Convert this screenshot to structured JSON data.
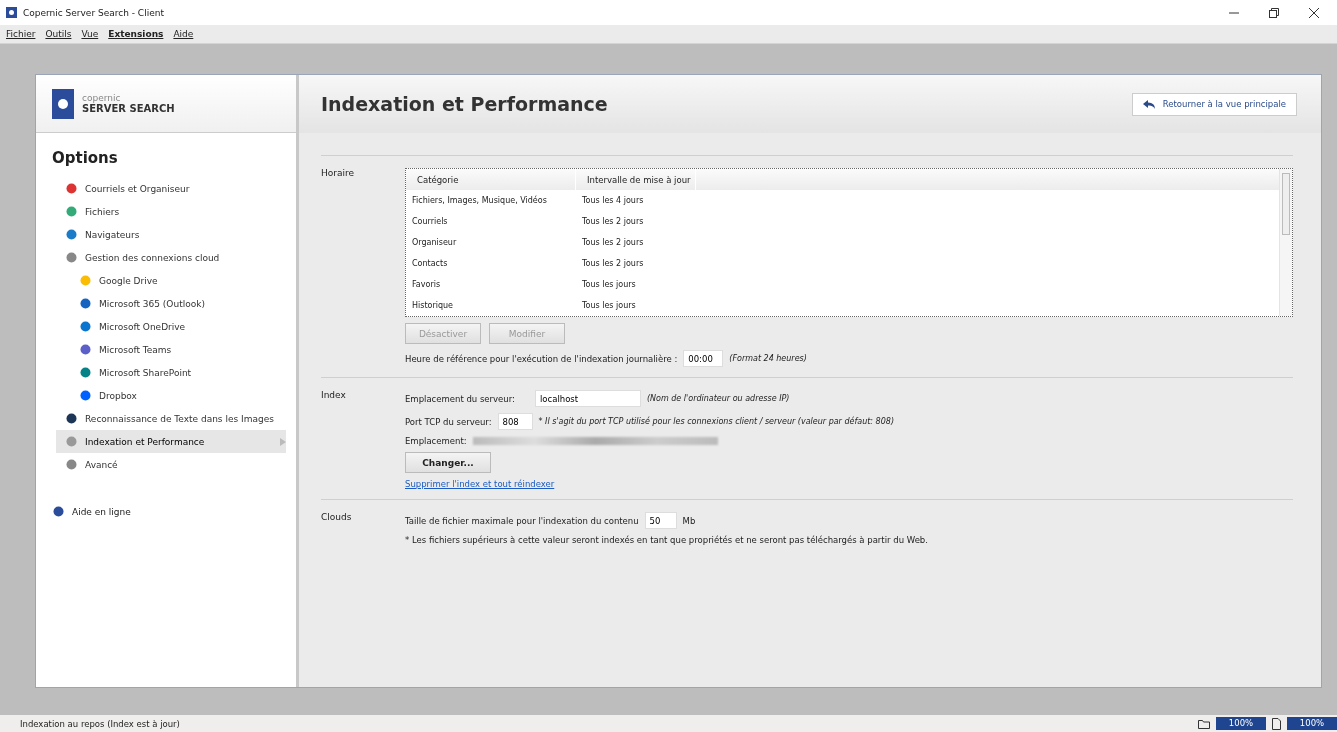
{
  "window": {
    "title": "Copernic Server Search - Client"
  },
  "menu": [
    "Fichier",
    "Outils",
    "Vue",
    "Extensions",
    "Aide"
  ],
  "logo": {
    "line1": "copernic",
    "line2": "SERVER SEARCH"
  },
  "sidebar": {
    "title": "Options",
    "items": [
      {
        "label": "Courriels et Organiseur",
        "selected": false
      },
      {
        "label": "Fichiers",
        "selected": false
      },
      {
        "label": "Navigateurs",
        "selected": false
      },
      {
        "label": "Gestion des connexions cloud",
        "selected": false,
        "children": [
          {
            "label": "Google Drive",
            "selected": false
          },
          {
            "label": "Microsoft 365 (Outlook)",
            "selected": false
          },
          {
            "label": "Microsoft OneDrive",
            "selected": false
          },
          {
            "label": "Microsoft Teams",
            "selected": false
          },
          {
            "label": "Microsoft SharePoint",
            "selected": false
          },
          {
            "label": "Dropbox",
            "selected": false
          }
        ]
      },
      {
        "label": "Reconnaissance de Texte dans les Images",
        "selected": false
      },
      {
        "label": "Indexation et Performance",
        "selected": true
      },
      {
        "label": "Avancé",
        "selected": false
      }
    ],
    "help": "Aide en ligne"
  },
  "page": {
    "title": "Indexation et Performance",
    "back_button": "Retourner à la vue principale"
  },
  "schedule": {
    "label": "Horaire",
    "columns": [
      "Catégorie",
      "Intervalle de mise à jour"
    ],
    "rows": [
      [
        "Fichiers, Images, Musique, Vidéos",
        "Tous les 4 jours"
      ],
      [
        "Courriels",
        "Tous les 2 jours"
      ],
      [
        "Organiseur",
        "Tous les 2 jours"
      ],
      [
        "Contacts",
        "Tous les 2 jours"
      ],
      [
        "Favoris",
        "Tous les jours"
      ],
      [
        "Historique",
        "Tous les jours"
      ]
    ],
    "buttons": [
      {
        "label": "Désactiver",
        "disabled": true
      },
      {
        "label": "Modifier",
        "disabled": true
      }
    ],
    "time_label": "Heure de référence pour l'exécution de l'indexation journalière :",
    "time_value": "00:00",
    "time_hint": "(Format 24 heures)"
  },
  "index": {
    "label": "Index",
    "server_label": "Emplacement du serveur:",
    "server_value": "localhost",
    "server_hint": "(Nom de l'ordinateur ou adresse IP)",
    "port_label": "Port TCP du serveur:",
    "port_value": "808",
    "port_hint": "* Il s'agit du port TCP utilisé pour les connexions client / serveur (valeur par défaut: 808)",
    "location_label": "Emplacement:",
    "change_button": "Changer...",
    "reindex_link": "Supprimer l'index et tout réindexer"
  },
  "clouds": {
    "label": "Clouds",
    "size_label": "Taille de fichier maximale pour l'indexation du contenu",
    "size_value": "50",
    "size_unit": "Mb",
    "note": "* Les fichiers supérieurs à cette valeur seront indexés en tant que propriétés et ne seront pas téléchargés à partir du Web."
  },
  "status_bar": {
    "text": "Indexation au repos (Index est à jour)",
    "zoom1": "100%",
    "zoom2": "100%"
  }
}
